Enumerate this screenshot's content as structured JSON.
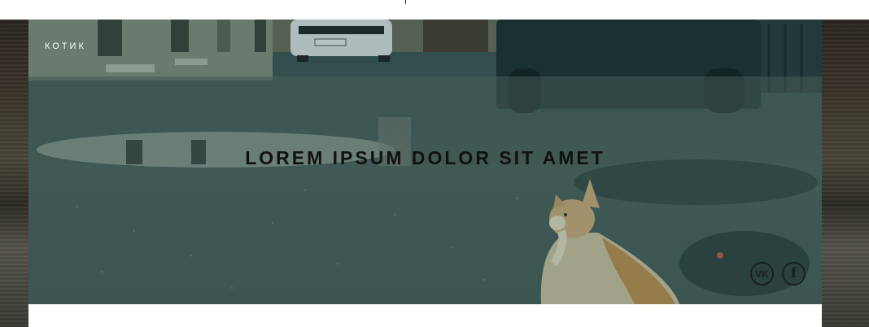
{
  "header": {
    "brand": "КОТИК"
  },
  "hero": {
    "headline": "LOREM IPSUM DOLOR SIT AMET",
    "image_icon": "cat-in-street-photo",
    "tint_color": "#1e5a5a"
  },
  "socials": [
    {
      "label": "VK",
      "icon": "vk-icon"
    },
    {
      "label": "f",
      "icon": "facebook-icon"
    }
  ]
}
